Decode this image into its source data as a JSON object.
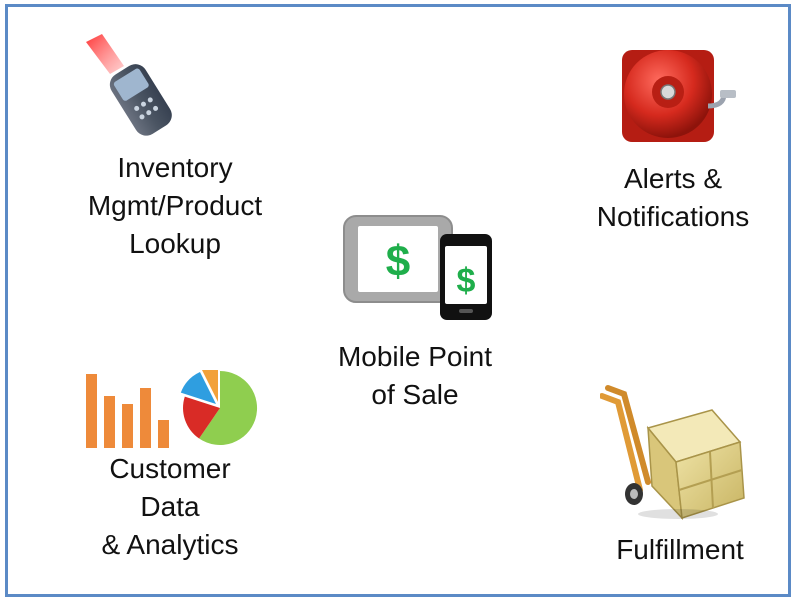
{
  "items": {
    "inventory": {
      "lines": [
        "Inventory",
        "Mgmt/Product",
        "Lookup"
      ],
      "icon": "barcode-scanner-icon"
    },
    "alerts": {
      "lines": [
        "Alerts &",
        "Notifications"
      ],
      "icon": "alarm-bell-icon"
    },
    "mpos": {
      "lines": [
        "Mobile Point",
        "of Sale"
      ],
      "icon": "tablet-phone-dollar-icon"
    },
    "analytics": {
      "lines": [
        "Customer",
        "Data",
        "& Analytics"
      ],
      "icon": "bar-pie-chart-icon"
    },
    "fulfillment": {
      "lines": [
        "Fulfillment"
      ],
      "icon": "hand-truck-crate-icon"
    }
  },
  "colors": {
    "border": "#5b8ac6",
    "dollar_green": "#1fae4b",
    "bar_orange": "#ee8a3a",
    "alarm_red": "#d62a1e"
  }
}
